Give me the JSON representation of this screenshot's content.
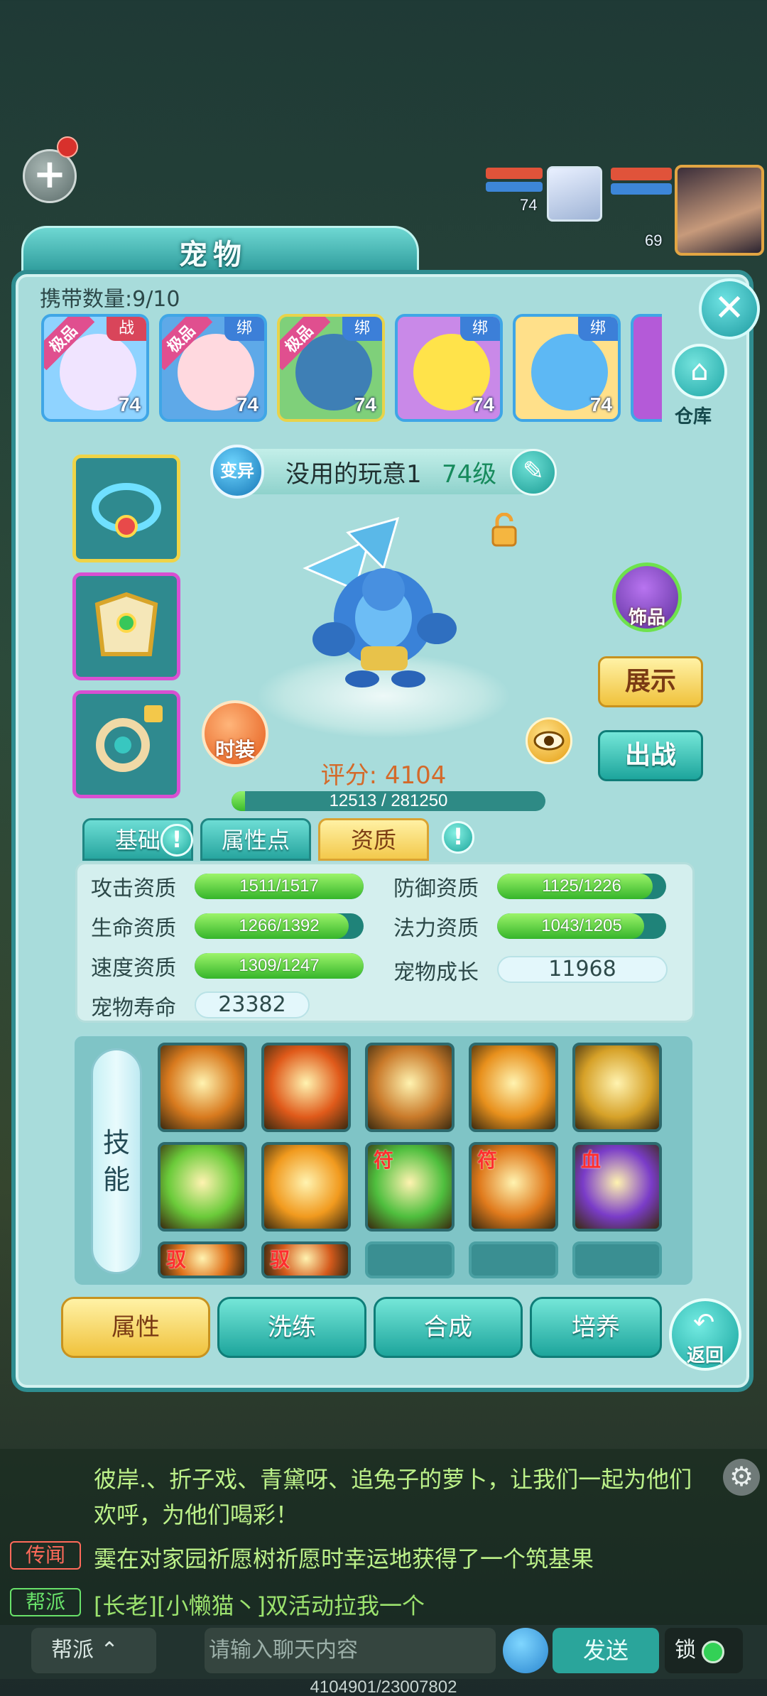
{
  "panel": {
    "title": "宠物",
    "carry_count": "携带数量:9/10",
    "warehouse_label": "仓库"
  },
  "hud": {
    "ally_level": "74",
    "hero_level": "69"
  },
  "pets": [
    {
      "quality": "极品",
      "status": "战",
      "level": "74",
      "color": "#f0e4ff"
    },
    {
      "quality": "极品",
      "status": "绑",
      "level": "74",
      "color": "#ffd9df"
    },
    {
      "quality": "极品",
      "status": "绑",
      "level": "74",
      "color": "#3e7fb5"
    },
    {
      "quality": "",
      "status": "绑",
      "level": "74",
      "color": "#ffe34a"
    },
    {
      "quality": "",
      "status": "绑",
      "level": "74",
      "color": "#5db8f4"
    }
  ],
  "pet": {
    "race_badge": "变异",
    "name": "没用的玩意1",
    "level": "74级",
    "score": "评分: 4104",
    "exp_text": "12513 / 281250",
    "exp_progress": 0.044
  },
  "buttons": {
    "decor": "饰品",
    "show": "展示",
    "fight": "出战",
    "costume": "时装",
    "back": "返回"
  },
  "tabs": [
    "基础",
    "属性点",
    "资质"
  ],
  "tab_alert": "!",
  "aptitude": {
    "attack": {
      "label": "攻击资质",
      "text": "1511/1517",
      "ratio": 1.0
    },
    "defense": {
      "label": "防御资质",
      "text": "1125/1226",
      "ratio": 0.92
    },
    "hp": {
      "label": "生命资质",
      "text": "1266/1392",
      "ratio": 0.91
    },
    "magic": {
      "label": "法力资质",
      "text": "1043/1205",
      "ratio": 0.87
    },
    "speed": {
      "label": "速度资质",
      "text": "1309/1247",
      "ratio": 1.0
    },
    "growth": {
      "label": "宠物成长",
      "value": "11968"
    },
    "life": {
      "label": "宠物寿命",
      "value": "23382"
    }
  },
  "skills": {
    "label": "技能",
    "rows": [
      [
        {
          "mark": "",
          "color": "#d87a1e"
        },
        {
          "mark": "",
          "color": "#e05a1a"
        },
        {
          "mark": "",
          "color": "#c97a2a"
        },
        {
          "mark": "",
          "color": "#e8901c"
        },
        {
          "mark": "",
          "color": "#d6a128"
        }
      ],
      [
        {
          "mark": "",
          "color": "#6bcb3a"
        },
        {
          "mark": "",
          "color": "#f19a1e"
        },
        {
          "mark": "符",
          "color": "#4fbf3e"
        },
        {
          "mark": "符",
          "color": "#e07a1c"
        },
        {
          "mark": "血",
          "color": "#7a3cc8"
        }
      ],
      [
        {
          "mark": "驭",
          "color": "#e0721c"
        },
        {
          "mark": "驭",
          "color": "#d45a1c"
        },
        {
          "mark": "",
          "color": ""
        },
        {
          "mark": "",
          "color": ""
        },
        {
          "mark": "",
          "color": ""
        }
      ]
    ]
  },
  "bottom_tabs": [
    "属性",
    "洗练",
    "合成",
    "培养"
  ],
  "chat": {
    "line1": "彼岸.、折子戏、青黛呀、追兔子的萝卜，让我们一起为他们",
    "line2": "欢呼，为他们喝彩！",
    "channel_rumor": "传闻",
    "line3": "霙在对家园祈愿树祈愿时幸运地获得了一个筑基果",
    "channel_guild": "帮派",
    "line4": "[长老][小懒猫丶]双活动拉我一个",
    "channel_button": "帮派",
    "input_placeholder": "请输入聊天内容",
    "send": "发送",
    "lock": "锁",
    "footer": "4104901/23007802"
  },
  "colors": {
    "panel_bg": "#a8dcdb",
    "accent_teal": "#1da59c",
    "accent_yellow": "#f0c23c"
  }
}
